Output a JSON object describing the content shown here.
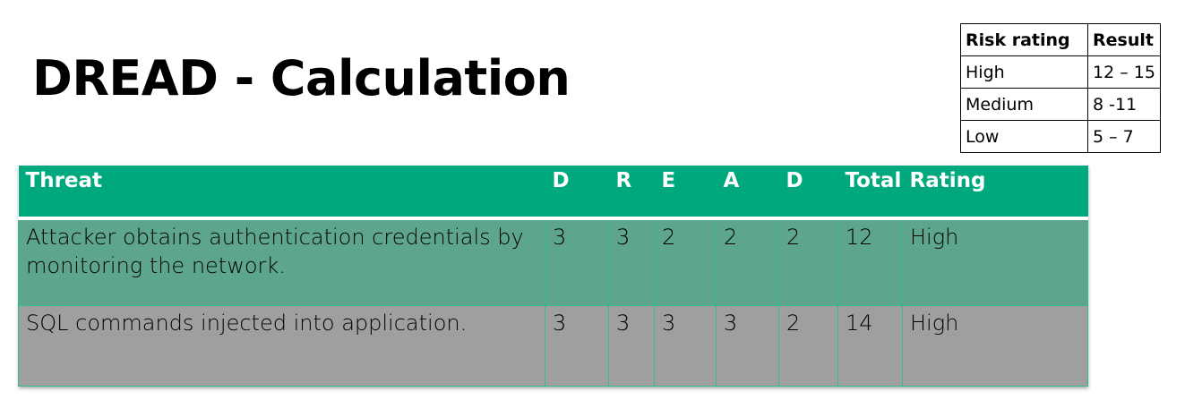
{
  "title": "DREAD - Calculation",
  "legend": {
    "headers": [
      "Risk rating",
      "Result"
    ],
    "rows": [
      [
        "High",
        "12 – 15"
      ],
      [
        "Medium",
        "8 -11"
      ],
      [
        "Low",
        "5 – 7"
      ]
    ]
  },
  "dread_table": {
    "headers": [
      "Threat",
      "D",
      "R",
      "E",
      "A",
      "D",
      "Total",
      "Rating"
    ],
    "rows": [
      [
        "Attacker obtains authentication credentials by monitoring the network.",
        "3",
        "3",
        "2",
        "2",
        "2",
        "12",
        "High"
      ],
      [
        "SQL commands injected into application.",
        "3",
        "3",
        "3",
        "3",
        "2",
        "14",
        "High"
      ]
    ]
  },
  "colors": {
    "header_green": "#00a87e",
    "row1_green": "#5ea590",
    "row2_gray": "#9f9f9f"
  }
}
